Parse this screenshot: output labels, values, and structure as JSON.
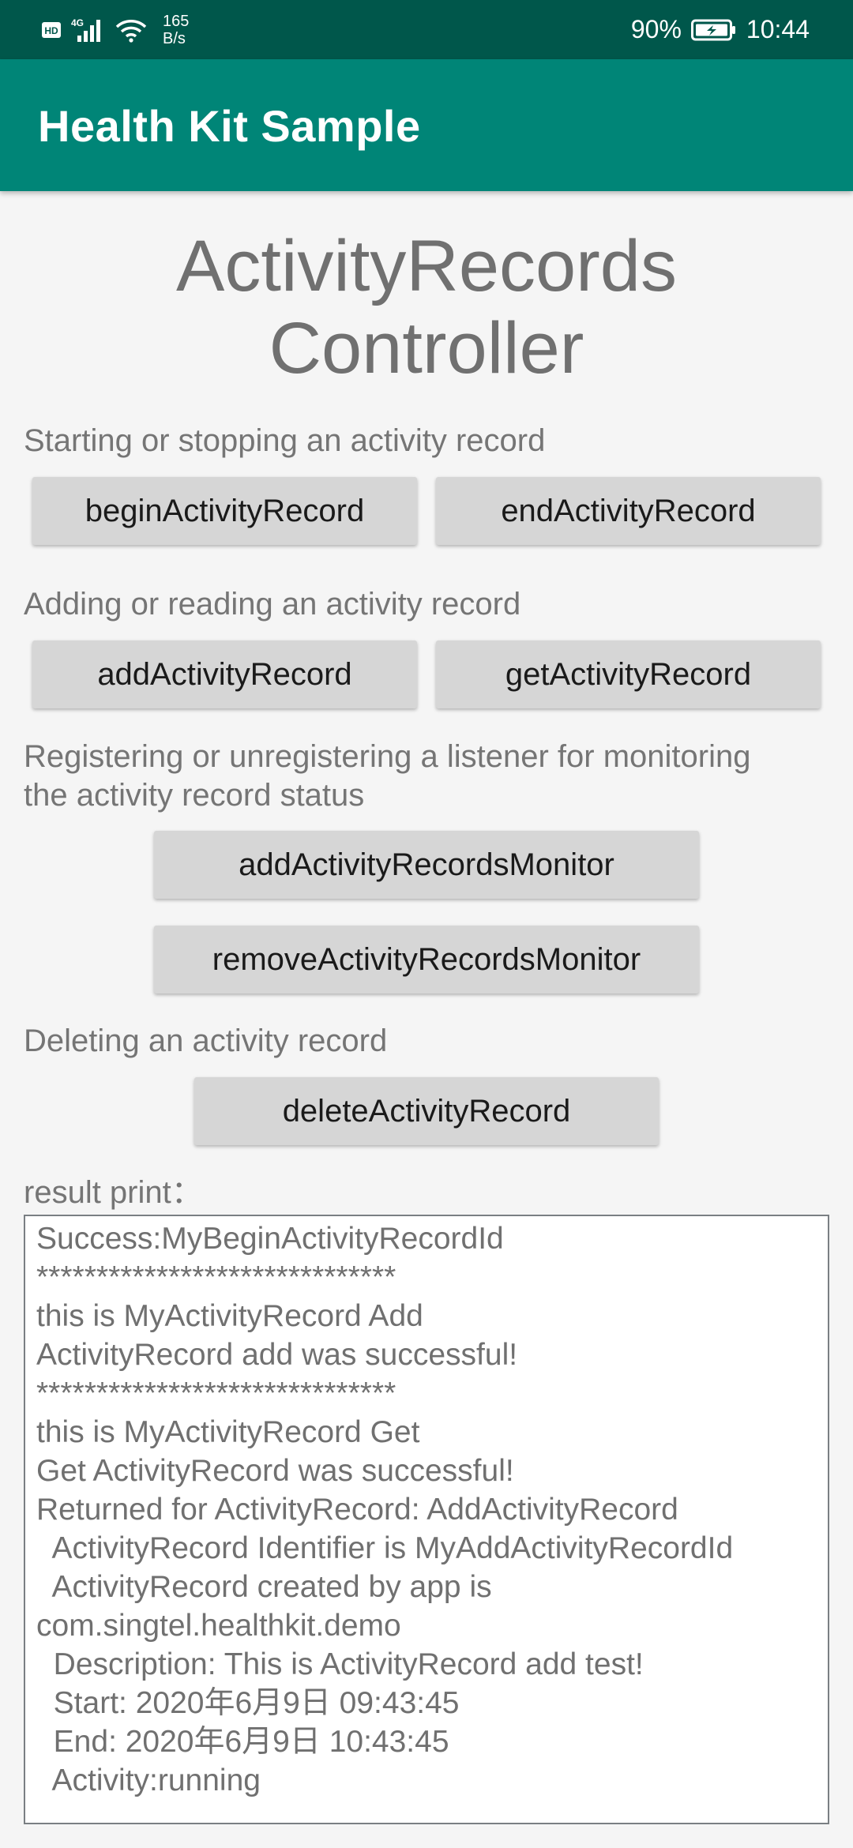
{
  "status_bar": {
    "network_labels": [
      "HD",
      "4G"
    ],
    "speed_value": "165",
    "speed_unit": "B/s",
    "battery": "90%",
    "time": "10:44"
  },
  "app_bar": {
    "title": "Health Kit Sample"
  },
  "page": {
    "title_line1": "ActivityRecords",
    "title_line2": "Controller"
  },
  "sections": {
    "start_stop": {
      "label": "Starting or stopping an activity record",
      "begin_button": "beginActivityRecord",
      "end_button": "endActivityRecord"
    },
    "add_read": {
      "label": "Adding or reading an activity record",
      "add_button": "addActivityRecord",
      "get_button": "getActivityRecord"
    },
    "monitor": {
      "label_line1": "Registering or unregistering a listener for monitoring",
      "label_line2": "the activity record status",
      "add_monitor_button": "addActivityRecordsMonitor",
      "remove_monitor_button": "removeActivityRecordsMonitor"
    },
    "delete": {
      "label": "Deleting an activity record",
      "delete_button": "deleteActivityRecord"
    }
  },
  "result": {
    "label": "result print：",
    "lines": [
      "Success:MyBeginActivityRecordId",
      "******************************",
      "this is MyActivityRecord Add",
      "ActivityRecord add was successful!",
      "******************************",
      "this is MyActivityRecord Get",
      "Get ActivityRecord was successful!",
      "Returned for ActivityRecord: AddActivityRecord",
      "  ActivityRecord Identifier is MyAddActivityRecordId",
      "  ActivityRecord created by app is",
      "com.singtel.healthkit.demo",
      "  Description: This is ActivityRecord add test!",
      "  Start: 2020年6月9日 09:43:45",
      "  End: 2020年6月9日 10:43:45",
      "  Activity:running"
    ]
  },
  "colors": {
    "status_bar": "#00574b",
    "app_bar": "#008577",
    "button": "#d6d6d6",
    "background": "#f5f5f5"
  },
  "icons": [
    "hd-icon",
    "signal-icon",
    "wifi-icon",
    "battery-charging-icon"
  ]
}
